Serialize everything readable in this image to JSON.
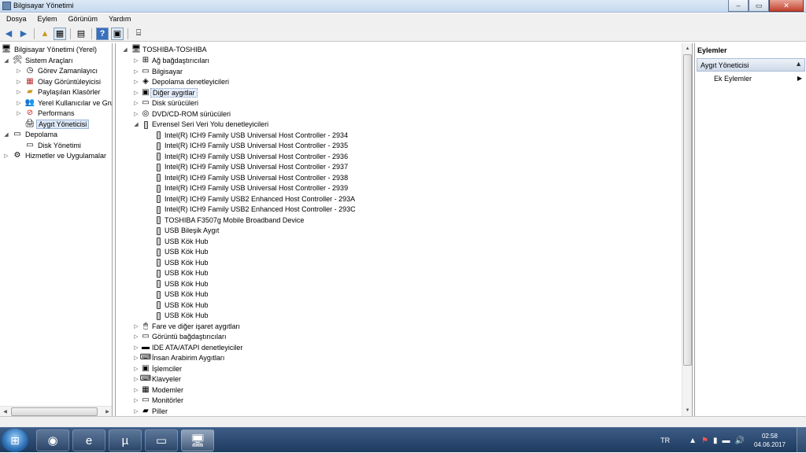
{
  "window": {
    "title": "Bilgisayar Yönetimi",
    "minimize": "–",
    "maximize": "▭",
    "close": "✕"
  },
  "menu": [
    "Dosya",
    "Eylem",
    "Görünüm",
    "Yardım"
  ],
  "tree": {
    "root": "Bilgisayar Yönetimi (Yerel)",
    "system_tools": "Sistem Araçları",
    "tools": [
      "Görev Zamanlayıcı",
      "Olay Görüntüleyicisi",
      "Paylaşılan Klasörler",
      "Yerel Kullanıcılar ve Gru",
      "Performans",
      "Aygıt Yöneticisi"
    ],
    "storage": "Depolama",
    "disk_mgmt": "Disk Yönetimi",
    "services": "Hizmetler ve Uygulamalar"
  },
  "devices": {
    "computer": "TOSHIBA-TOSHIBA",
    "before": [
      "Ağ bağdaştırıcıları",
      "Bilgisayar",
      "Depolama denetleyicileri",
      "Diğer aygıtlar",
      "Disk sürücüleri",
      "DVD/CD-ROM sürücüleri"
    ],
    "usb_group": "Evrensel Seri Veri Yolu denetleyicileri",
    "usb_children": [
      "Intel(R) ICH9 Family USB Universal Host Controller - 2934",
      "Intel(R) ICH9 Family USB Universal Host Controller - 2935",
      "Intel(R) ICH9 Family USB Universal Host Controller - 2936",
      "Intel(R) ICH9 Family USB Universal Host Controller - 2937",
      "Intel(R) ICH9 Family USB Universal Host Controller - 2938",
      "Intel(R) ICH9 Family USB Universal Host Controller - 2939",
      "Intel(R) ICH9 Family USB2 Enhanced Host Controller - 293A",
      "Intel(R) ICH9 Family USB2 Enhanced Host Controller - 293C",
      "TOSHIBA F3507g Mobile Broadband Device",
      "USB Bileşik Aygıt",
      "USB Kök Hub",
      "USB Kök Hub",
      "USB Kök Hub",
      "USB Kök Hub",
      "USB Kök Hub",
      "USB Kök Hub",
      "USB Kök Hub",
      "USB Kök Hub"
    ],
    "after": [
      "Fare ve diğer işaret aygıtları",
      "Görüntü bağdaştırıcıları",
      "IDE ATA/ATAPI denetleyiciler",
      "İnsan Arabirim Aygıtları",
      "İşlemciler",
      "Klavyeler",
      "Modemler",
      "Monitörler",
      "Piller"
    ]
  },
  "actions": {
    "header": "Eylemler",
    "section": "Aygıt Yöneticisi",
    "more": "Ek Eylemler"
  },
  "taskbar": {
    "lang": "TR",
    "time": "02:58",
    "date": "04.06.2017"
  },
  "colors": {
    "selection": "#dde8f6",
    "taskbar": "#1e3a5f"
  }
}
